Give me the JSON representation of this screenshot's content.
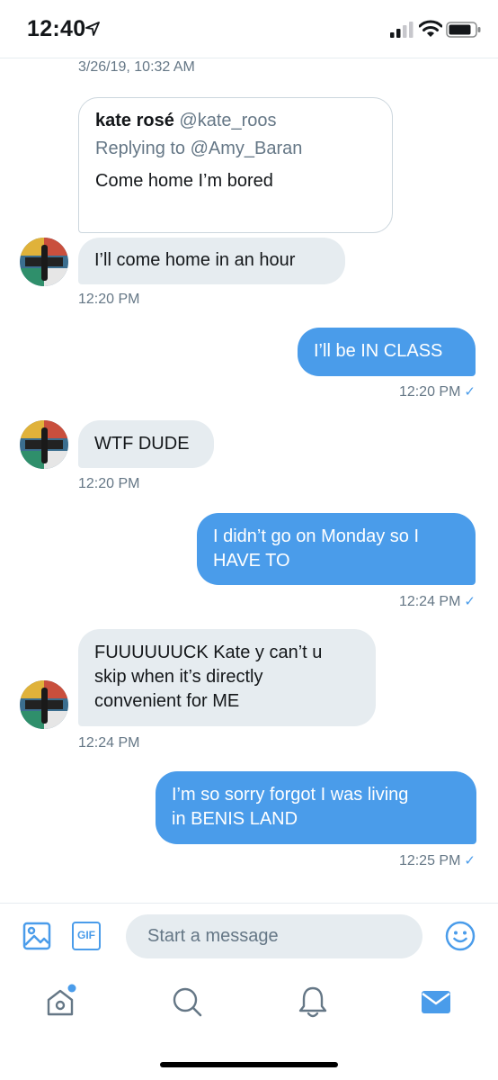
{
  "status_bar": {
    "time": "12:40"
  },
  "conversation": {
    "date_header": "3/26/19, 10:32 AM",
    "quoted_tweet": {
      "name": "kate rosé",
      "handle": "@kate_roos",
      "replying_to": "Replying to @Amy_Baran",
      "text": "Come home I’m bored"
    },
    "messages": [
      {
        "direction": "in",
        "text": "I’ll come home in an hour",
        "time": "12:20 PM"
      },
      {
        "direction": "out",
        "text": "I’ll be IN CLASS",
        "time": "12:20 PM"
      },
      {
        "direction": "in",
        "text": "WTF DUDE",
        "time": "12:20 PM"
      },
      {
        "direction": "out",
        "lines": [
          "I didn’t go on Monday so I",
          "HAVE TO"
        ],
        "time": "12:24 PM"
      },
      {
        "direction": "in",
        "lines": [
          "FUUUUUUCK Kate y can’t u",
          "skip when it’s directly",
          "convenient for ME"
        ],
        "time": "12:24 PM"
      },
      {
        "direction": "out",
        "lines": [
          "I’m so sorry forgot I was living",
          "in BENIS LAND"
        ],
        "time": "12:25 PM"
      }
    ],
    "read_check": "✓"
  },
  "composer": {
    "placeholder": "Start a message",
    "gif_label": "GIF"
  },
  "tab_bar": {
    "items": [
      "home",
      "search",
      "notifications",
      "messages"
    ],
    "active": "messages"
  },
  "colors": {
    "accent": "#4a9cea",
    "bubble_in": "#e6ecf0",
    "muted_text": "#657786"
  }
}
